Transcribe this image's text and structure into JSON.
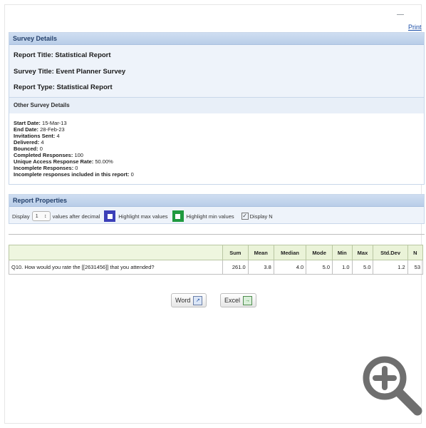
{
  "header": {
    "print_label": "Print"
  },
  "survey_details": {
    "section_title": "Survey Details",
    "report_title": "Report Title: Statistical Report",
    "survey_title": "Survey Title: Event Planner Survey",
    "report_type": "Report Type: Statistical Report"
  },
  "other_details": {
    "section_title": "Other Survey Details",
    "lines": [
      {
        "label": "Start Date:",
        "value": "15-Mar-13"
      },
      {
        "label": "End Date:",
        "value": "28-Feb-23"
      },
      {
        "label": "Invitations Sent:",
        "value": "4"
      },
      {
        "label": "Delivered:",
        "value": "4"
      },
      {
        "label": "Bounced:",
        "value": "0"
      },
      {
        "label": "Completed Responses:",
        "value": "100"
      },
      {
        "label": "Unique Access Response Rate:",
        "value": "50.00%"
      },
      {
        "label": "Incomplete Responses:",
        "value": "0"
      },
      {
        "label": "Incomplete responses included in this report:",
        "value": "0"
      }
    ]
  },
  "report_properties": {
    "section_title": "Report Properties",
    "display_label": "Display",
    "decimal_value": "1",
    "after_decimal_label": "values after decimal",
    "highlight_max_label": "Highlight max values",
    "highlight_min_label": "Highlight min values",
    "display_n_label": "Display N",
    "highlight_max_color": "#3b3fb8",
    "highlight_min_color": "#1f9a3f"
  },
  "table": {
    "headers": [
      "",
      "Sum",
      "Mean",
      "Median",
      "Mode",
      "Min",
      "Max",
      "Std.Dev",
      "N"
    ],
    "rows": [
      [
        "Q10. How would you rate the [[2631456]] that you attended?",
        "261.0",
        "3.8",
        "4.0",
        "5.0",
        "1.0",
        "5.0",
        "1.2",
        "53"
      ]
    ]
  },
  "export": {
    "word_label": "Word",
    "excel_label": "Excel"
  },
  "icons": {
    "zoom": "zoom-in-icon"
  }
}
